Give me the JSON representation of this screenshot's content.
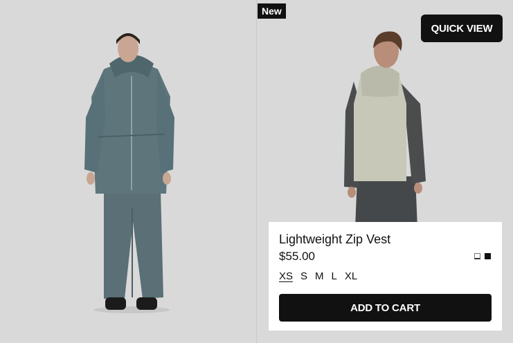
{
  "left_product": {
    "image_icon": "product-photo-rain-jacket-and-pants"
  },
  "right_product": {
    "badge": "New",
    "quick_view_label": "QUICK VIEW",
    "image_icon": "product-photo-zip-vest",
    "name": "Lightweight Zip Vest",
    "price": "$55.00",
    "colors": [
      {
        "name": "white",
        "hex": "#ffffff",
        "selected": true
      },
      {
        "name": "black",
        "hex": "#111111",
        "selected": false
      }
    ],
    "sizes": [
      "XS",
      "S",
      "M",
      "L",
      "XL"
    ],
    "selected_size": "XS",
    "add_to_cart_label": "ADD TO CART"
  },
  "colors": {
    "background": "#d9d9d9",
    "button": "#111111",
    "button_text": "#ffffff",
    "panel": "#ffffff"
  }
}
